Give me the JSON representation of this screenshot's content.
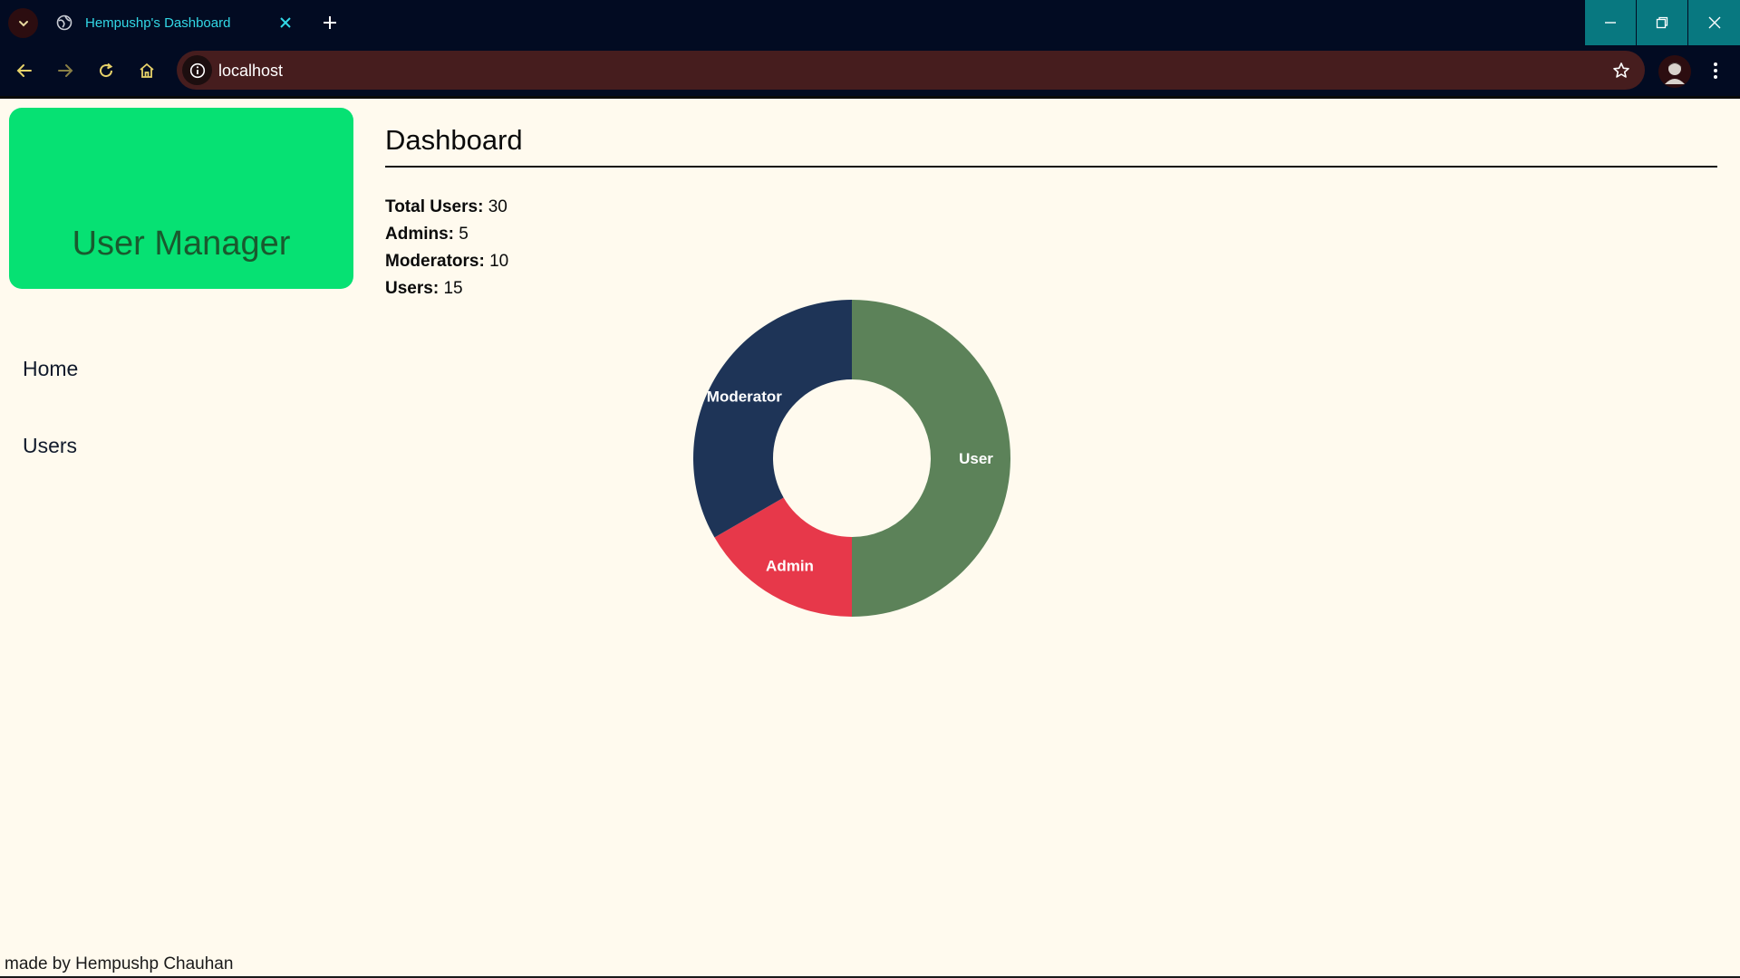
{
  "browser": {
    "tab_title": "Hempushp's Dashboard",
    "url": "localhost"
  },
  "sidebar": {
    "brand": "User Manager",
    "links": [
      {
        "label": "Home"
      },
      {
        "label": "Users"
      }
    ]
  },
  "dashboard": {
    "title": "Dashboard",
    "stats": [
      {
        "label": "Total Users:",
        "value": "30"
      },
      {
        "label": "Admins:",
        "value": "5"
      },
      {
        "label": "Moderators:",
        "value": "10"
      },
      {
        "label": "Users:",
        "value": "15"
      }
    ]
  },
  "chart_data": {
    "type": "pie",
    "donut": true,
    "categories": [
      "User",
      "Admin",
      "Moderator"
    ],
    "values": [
      15,
      5,
      10
    ],
    "colors": [
      "#5c8259",
      "#e7384a",
      "#1e3457"
    ],
    "start_angle_deg": 270,
    "label_color": "#ffffff"
  },
  "footer": {
    "credit": "made by Hempushp Chauhan"
  },
  "colors": {
    "brand_bg": "#06e173",
    "brand_text": "#195a2e",
    "page_bg": "#fffaee",
    "chrome_bg": "#020b22",
    "omnibox_bg": "#461d1e",
    "accent_tab": "#32d8e6",
    "window_controls": "#087880"
  }
}
